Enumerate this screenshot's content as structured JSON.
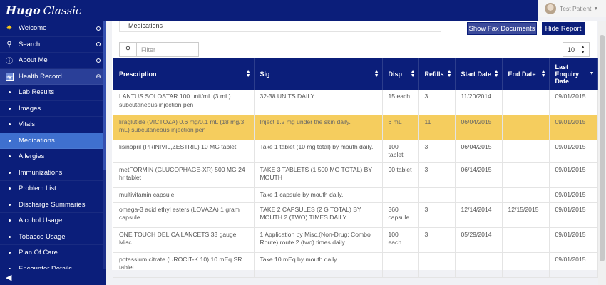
{
  "app": {
    "brand_bold": "Hugo",
    "brand_light": "Classic"
  },
  "user": {
    "name": "Test Patient"
  },
  "sidebar": {
    "items": [
      {
        "label": "Welcome"
      },
      {
        "label": "Search"
      },
      {
        "label": "About Me"
      },
      {
        "label": "Health Record"
      },
      {
        "label": "Lab Results"
      },
      {
        "label": "Images"
      },
      {
        "label": "Vitals"
      },
      {
        "label": "Medications"
      },
      {
        "label": "Allergies"
      },
      {
        "label": "Immunizations"
      },
      {
        "label": "Problem List"
      },
      {
        "label": "Discharge Summaries"
      },
      {
        "label": "Alcohol Usage"
      },
      {
        "label": "Tobacco Usage"
      },
      {
        "label": "Plan Of Care"
      },
      {
        "label": "Encounter Details"
      }
    ]
  },
  "main": {
    "breadcrumb": "Medications",
    "show_fax_label": "Show Fax Documents",
    "hide_report_label": "Hide Report",
    "filter_placeholder": "Filter",
    "page_size": "10",
    "columns": [
      "Prescription",
      "Sig",
      "Disp",
      "Refills",
      "Start Date",
      "End Date",
      "Last Enquiry Date"
    ],
    "rows": [
      [
        "LANTUS SOLOSTAR 100 unit/mL (3 mL) subcutaneous injection pen",
        "32-38 UNITS DAILY",
        "15 each",
        "3",
        "11/20/2014",
        "",
        "09/01/2015"
      ],
      [
        "liraglutide (VICTOZA) 0.6 mg/0.1 mL (18 mg/3 mL) subcutaneous injection pen",
        "Inject 1.2 mg under the skin daily.",
        "6 mL",
        "11",
        "06/04/2015",
        "",
        "09/01/2015"
      ],
      [
        "lisinopril (PRINIVIL,ZESTRIL) 10 MG tablet",
        "Take 1 tablet (10 mg total) by mouth daily.",
        "100 tablet",
        "3",
        "06/04/2015",
        "",
        "09/01/2015"
      ],
      [
        "metFORMIN (GLUCOPHAGE-XR) 500 MG 24 hr tablet",
        "TAKE 3 TABLETS (1,500 MG TOTAL) BY MOUTH",
        "90 tablet",
        "3",
        "06/14/2015",
        "",
        "09/01/2015"
      ],
      [
        "multivitamin capsule",
        "Take 1 capsule by mouth daily.",
        "",
        "",
        "",
        "",
        "09/01/2015"
      ],
      [
        "omega-3 acid ethyl esters (LOVAZA) 1 gram capsule",
        "TAKE 2 CAPSULES (2 G TOTAL) BY MOUTH 2 (TWO) TIMES DAILY.",
        "360 capsule",
        "3",
        "12/14/2014",
        "12/15/2015",
        "09/01/2015"
      ],
      [
        "ONE TOUCH DELICA LANCETS 33 gauge Misc",
        "1 Application by Misc.(Non-Drug; Combo Route) route 2 (two) times daily.",
        "100 each",
        "3",
        "05/29/2014",
        "",
        "09/01/2015"
      ],
      [
        "potassium citrate (UROCIT-K 10) 10 mEq SR tablet",
        "Take 10 mEq by mouth daily.",
        "",
        "",
        "",
        "",
        "09/01/2015"
      ]
    ]
  },
  "colors": {
    "navy": "#0b1e7a",
    "highlight": "#f5cd5e",
    "active_nav": "#3f70cf"
  }
}
